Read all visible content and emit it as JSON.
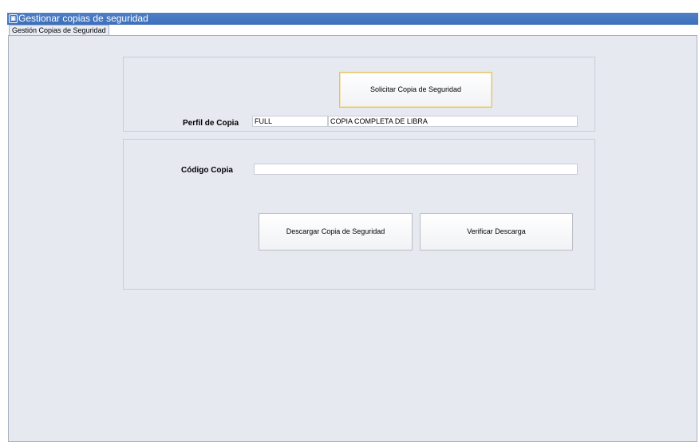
{
  "window": {
    "title": "Gestionar copias de seguridad",
    "icon": "app-window-icon"
  },
  "tabs": [
    {
      "label": "Gestión Copias de Seguridad",
      "selected": true
    }
  ],
  "request_panel": {
    "request_button_label": "Solicitar Copia de Seguridad",
    "profile_label": "Perfil de Copia",
    "profile_code": "FULL",
    "profile_description": "COPIA COMPLETA DE LIBRA"
  },
  "download_panel": {
    "code_label": "Código Copia",
    "code_value": "",
    "download_button_label": "Descargar Copia de Seguridad",
    "verify_button_label": "Verificar Descarga"
  },
  "colors": {
    "titlebar": "#3d6fbb",
    "content_background": "#e6e9f0",
    "focused_button_border": "#e1c36a"
  }
}
